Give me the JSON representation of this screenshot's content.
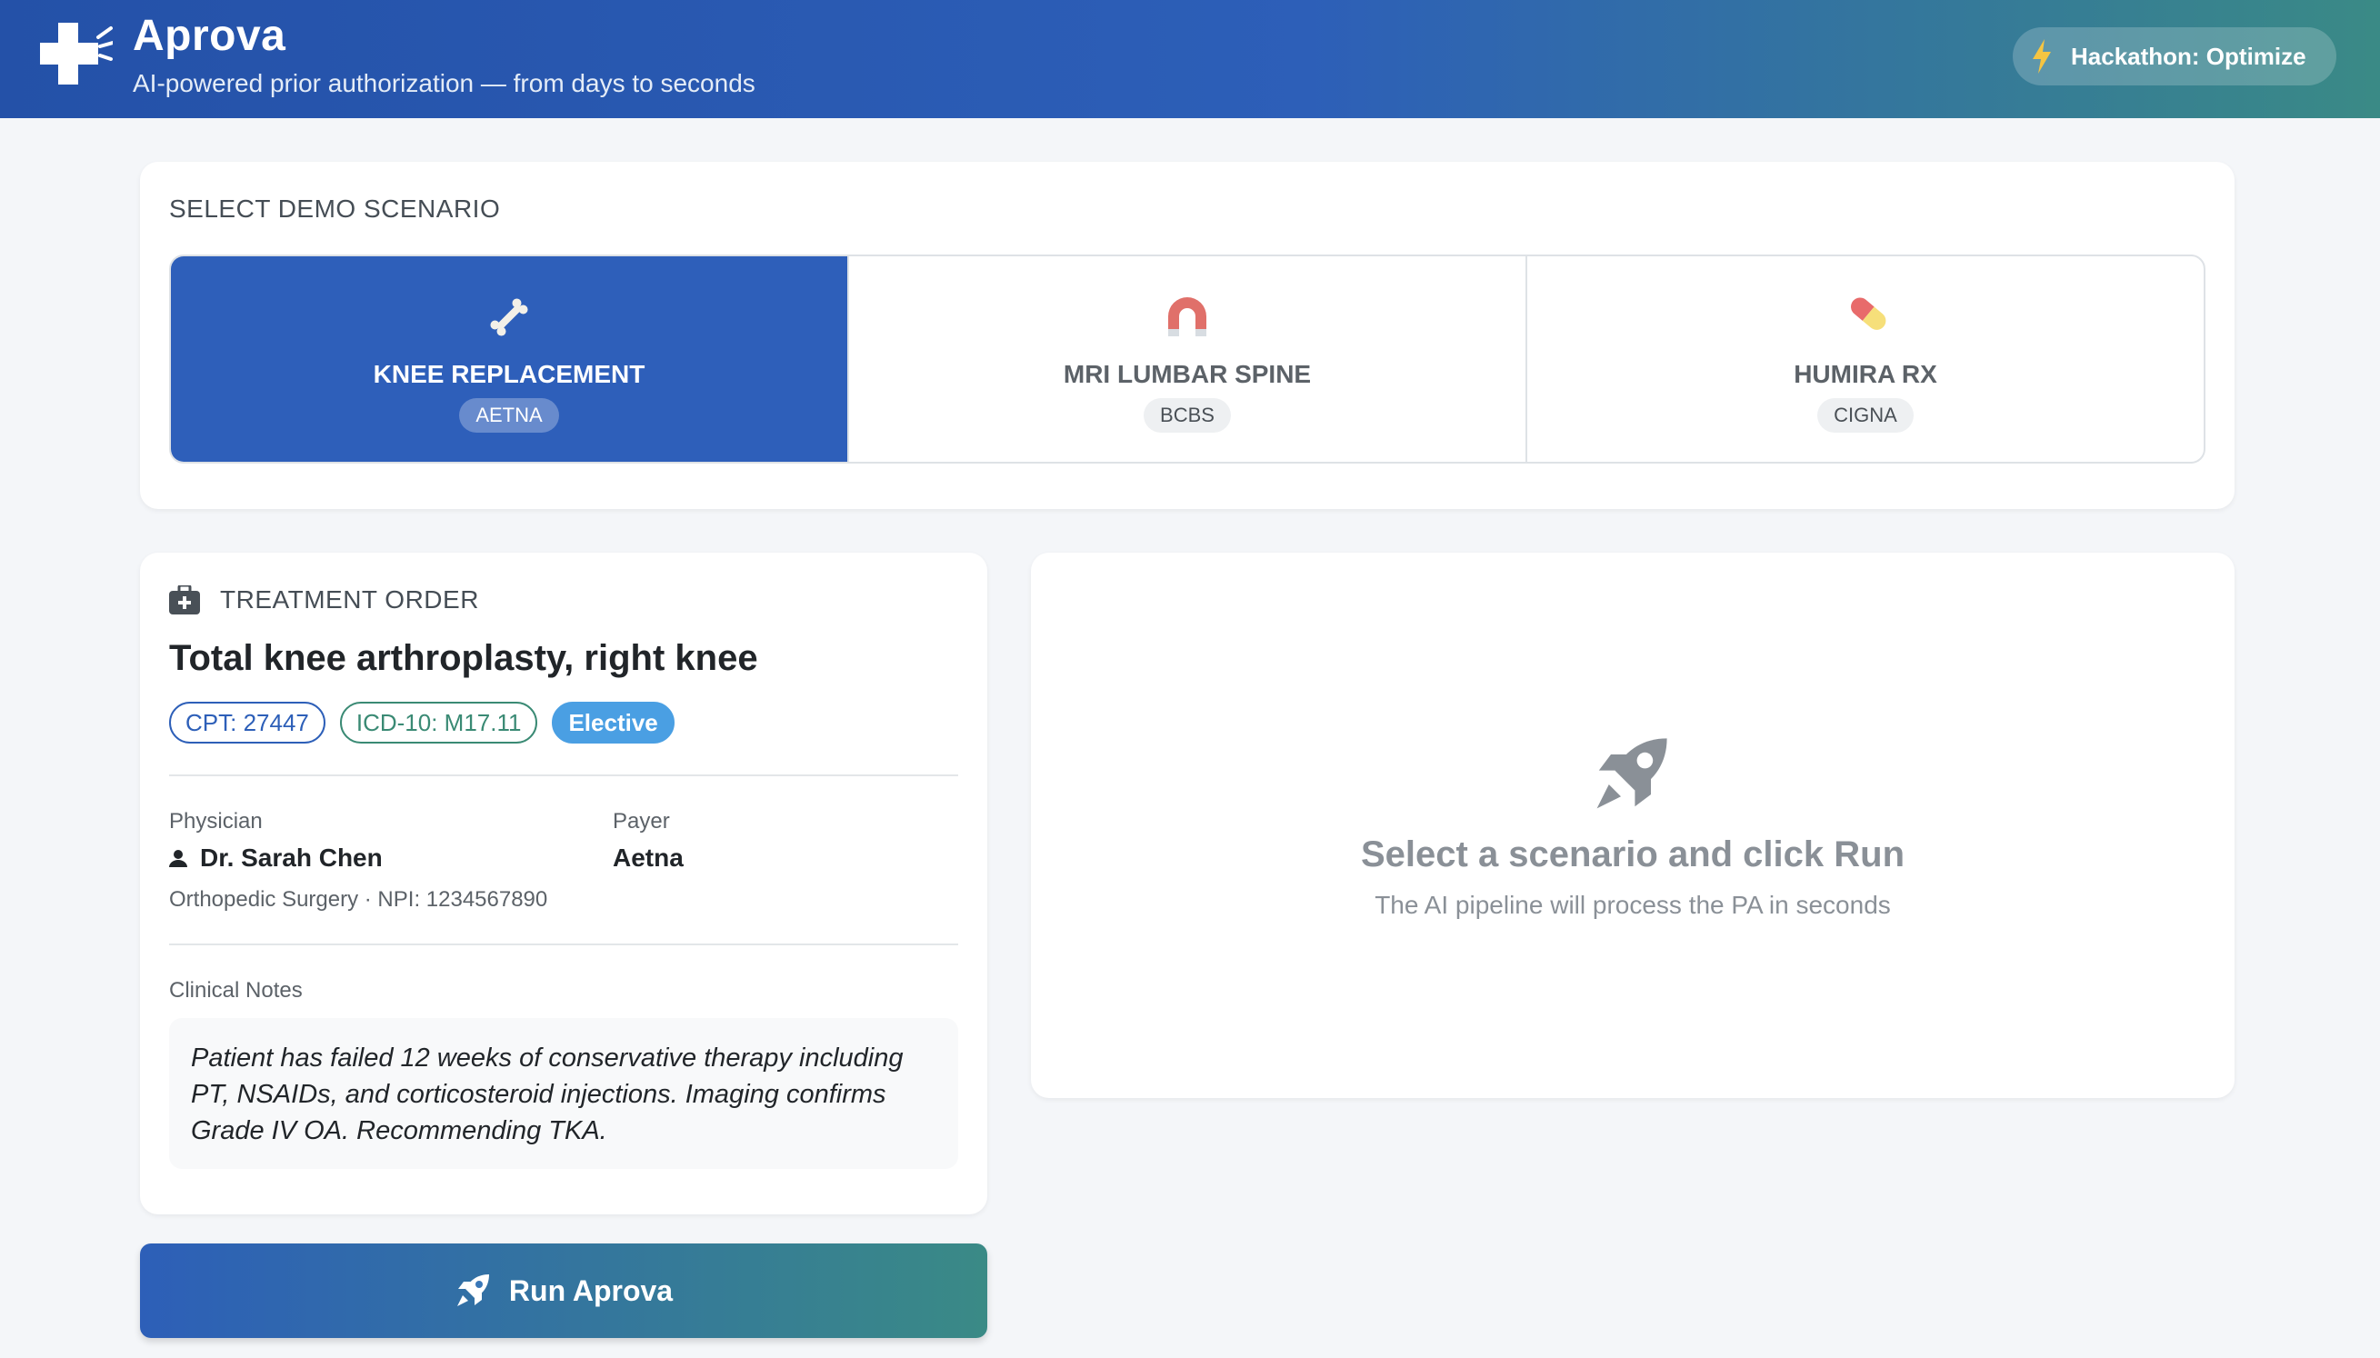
{
  "header": {
    "title": "Aprova",
    "subtitle": "AI-powered prior authorization — from days to seconds",
    "badge": "Hackathon: Optimize",
    "badge_icon": "lightning-icon",
    "logo_icon": "medical-cross-icon"
  },
  "scenario": {
    "section_label": "SELECT DEMO SCENARIO",
    "tabs": [
      {
        "label": "KNEE REPLACEMENT",
        "payer": "AETNA",
        "icon": "bone-icon",
        "active": true
      },
      {
        "label": "MRI LUMBAR SPINE",
        "payer": "BCBS",
        "icon": "magnet-icon",
        "active": false
      },
      {
        "label": "HUMIRA RX",
        "payer": "CIGNA",
        "icon": "pill-icon",
        "active": false
      }
    ]
  },
  "treatment": {
    "section_label": "TREATMENT ORDER",
    "title": "Total knee arthroplasty, right knee",
    "cpt": "CPT: 27447",
    "icd": "ICD-10: M17.11",
    "urgency": "Elective",
    "physician_label": "Physician",
    "physician_name": "Dr. Sarah Chen",
    "physician_detail": "Orthopedic Surgery · NPI: 1234567890",
    "payer_label": "Payer",
    "payer_name": "Aetna",
    "notes_label": "Clinical Notes",
    "notes": "Patient has failed 12 weeks of conservative therapy including PT, NSAIDs, and corticosteroid injections. Imaging confirms Grade IV OA. Recommending TKA."
  },
  "run_button": {
    "label": "Run Aprova",
    "icon": "rocket-icon"
  },
  "placeholder": {
    "title": "Select a scenario and click Run",
    "subtitle": "The AI pipeline will process the PA in seconds",
    "icon": "rocket-icon"
  },
  "colors": {
    "primary": "#2d5fb8",
    "teal": "#3a8a86",
    "elective": "#4a9fe3"
  }
}
